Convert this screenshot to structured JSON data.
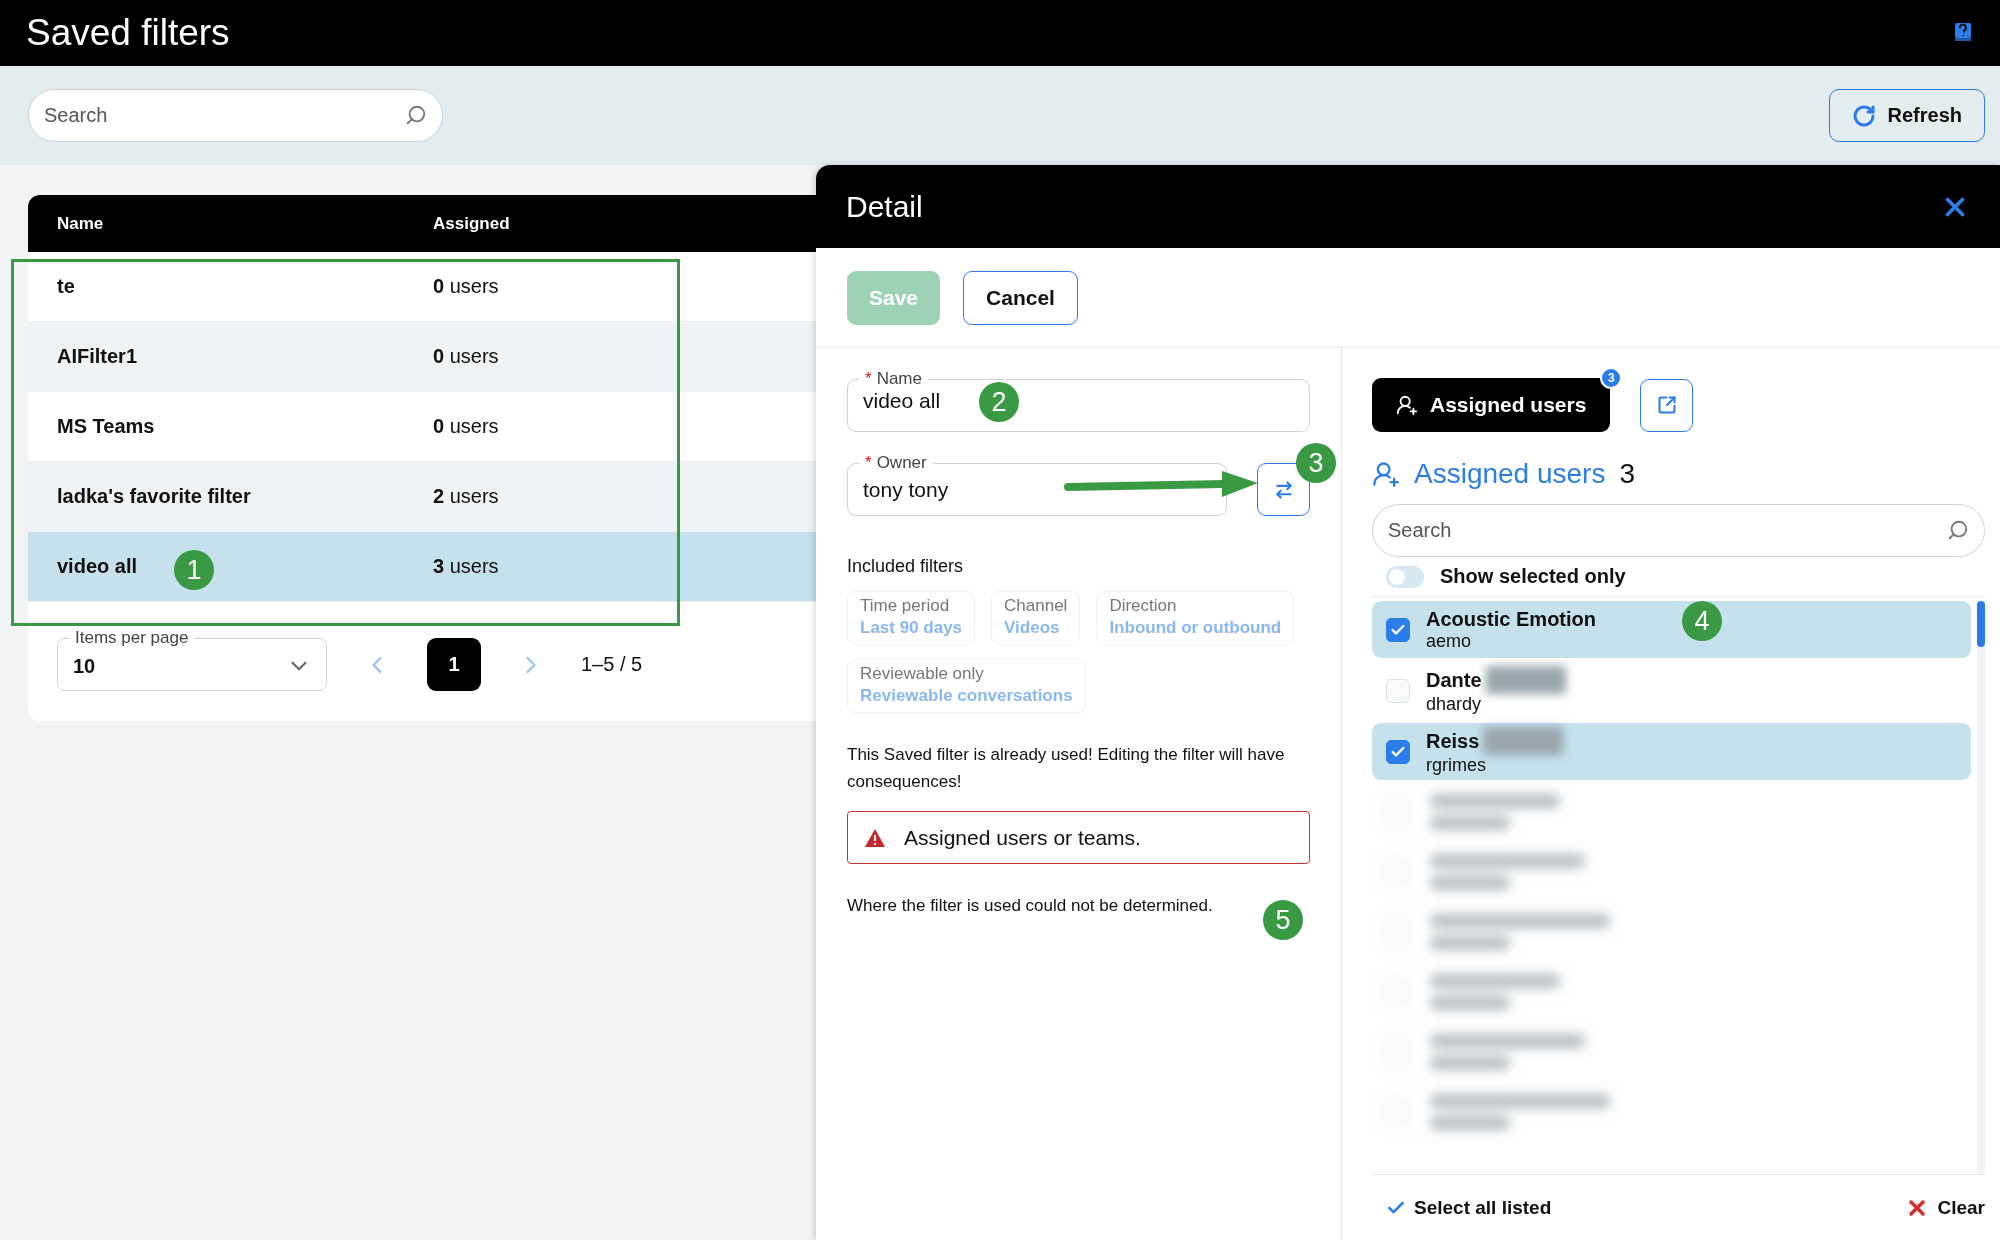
{
  "app": {
    "title": "Saved filters"
  },
  "toolbar": {
    "search_placeholder": "Search",
    "refresh_label": "Refresh"
  },
  "table": {
    "columns": [
      "Name",
      "Assigned"
    ],
    "rows": [
      {
        "name": "te",
        "assigned": "**0** users",
        "selected": false
      },
      {
        "name": "AIFilter1",
        "assigned": "**0** users",
        "selected": false
      },
      {
        "name": "MS Teams",
        "assigned": "**0** users",
        "selected": false
      },
      {
        "name": "ladka's favorite filter",
        "assigned": "**2** users",
        "selected": false
      },
      {
        "name": "video all",
        "assigned": "**3** users",
        "selected": true
      }
    ]
  },
  "pagination": {
    "label": "Items per page",
    "value": "10",
    "pages": [
      {
        "label": "1",
        "selected": true
      }
    ],
    "range": "1–5 / 5"
  },
  "detail": {
    "title": "Detail",
    "buttons": [
      {
        "label": "Save",
        "kind": "primary",
        "disabled": true
      },
      {
        "label": "Cancel",
        "kind": "outline",
        "disabled": false
      }
    ],
    "name_field": {
      "label": "Name",
      "value": "video all",
      "required_mark": "*"
    },
    "owner_field": {
      "label": "Owner",
      "value": "tony tony",
      "required_mark": "*"
    },
    "included_filters": {
      "title": "Included filters",
      "chips": [
        {
          "label": "Time period",
          "value": "Last 90 days"
        },
        {
          "label": "Channel",
          "value": "Videos"
        },
        {
          "label": "Direction",
          "value": "Inbound or outbound"
        },
        {
          "label": "Reviewable only",
          "value": "Reviewable conversations"
        }
      ]
    },
    "warning": "This Saved filter is already used! Editing the filter will have consequences!",
    "error": "Assigned users or teams.",
    "note": "Where the filter is used could not be determined."
  },
  "assigned": {
    "tab_label": "Assigned users",
    "badge": "3",
    "heading": "Assigned users",
    "count": "3",
    "search_placeholder": "Search",
    "toggle": {
      "label": "Show selected only",
      "on": false
    },
    "users": [
      {
        "kind": "user",
        "name": "Acoustic Emotion",
        "login": "aemo",
        "checked": true,
        "redacted": false
      },
      {
        "kind": "user",
        "name": "Dante",
        "login": "dhardy",
        "checked": false,
        "redacted": true
      },
      {
        "kind": "user",
        "name": "Reiss",
        "login": "rgrimes",
        "checked": true,
        "redacted": true
      },
      {
        "kind": "blurred"
      },
      {
        "kind": "blurred"
      },
      {
        "kind": "blurred"
      },
      {
        "kind": "blurred"
      },
      {
        "kind": "blurred"
      },
      {
        "kind": "blurred"
      }
    ],
    "select_all": "Select all listed",
    "clear": "Clear"
  },
  "annotations": [
    {
      "label": "1"
    },
    {
      "label": "2"
    },
    {
      "label": "3"
    },
    {
      "label": "4"
    },
    {
      "label": "5"
    }
  ]
}
